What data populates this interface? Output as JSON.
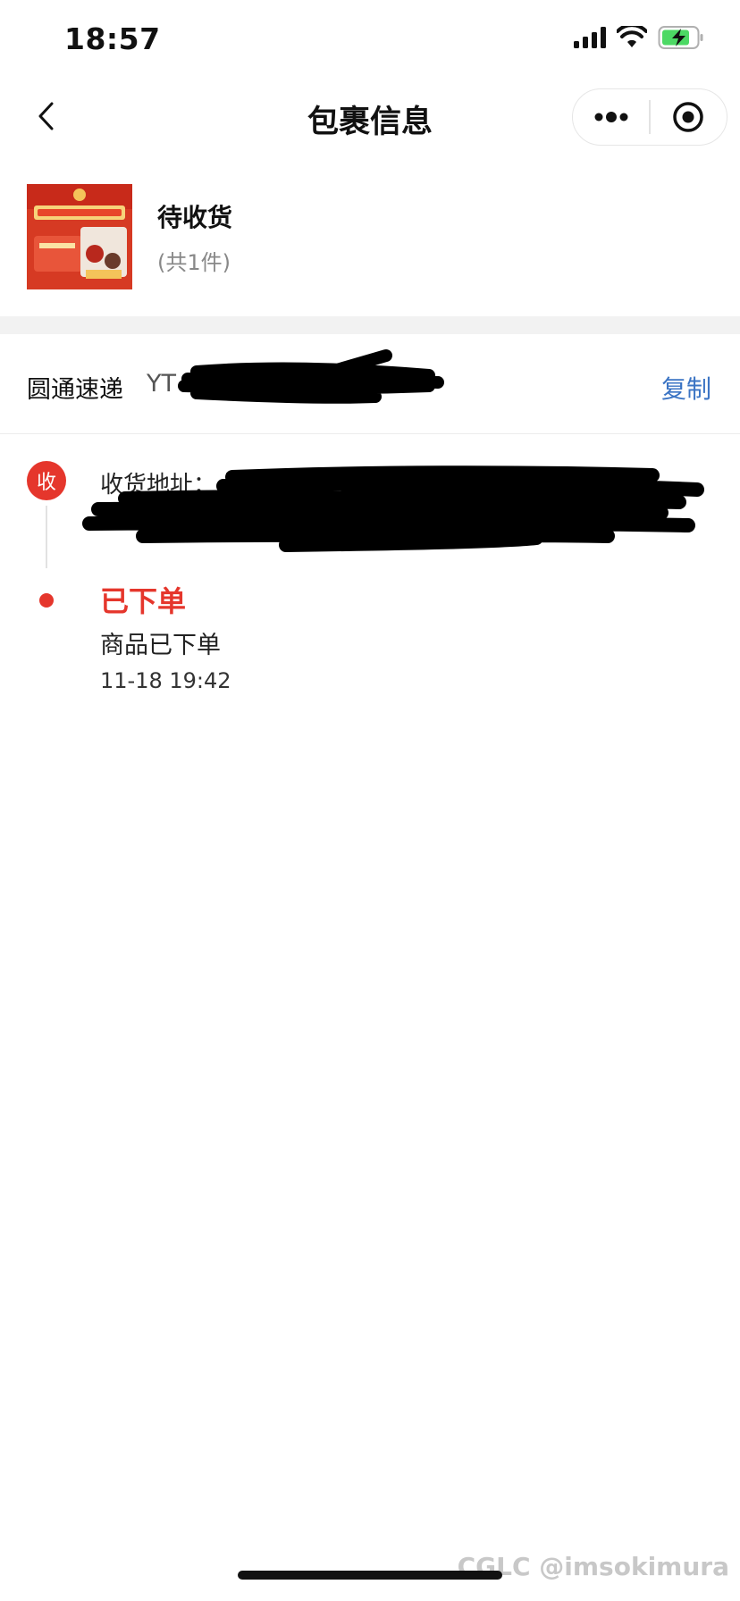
{
  "status_bar": {
    "time": "18:57",
    "icons": [
      "cellular-signal-icon",
      "wifi-icon",
      "battery-charging-icon"
    ],
    "battery_color": "#4cd964"
  },
  "nav": {
    "title": "包裹信息",
    "back_icon": "chevron-left-icon",
    "more_icon": "more-dots-icon",
    "close_icon": "target-circle-icon"
  },
  "product": {
    "status": "待收货",
    "count": "(共1件)"
  },
  "courier": {
    "name": "圆通速递",
    "tracking_visible": "YT",
    "copy_label": "复制"
  },
  "timeline": {
    "badge": "收",
    "address_label": "收货地址：上",
    "steps": [
      {
        "title": "已下单",
        "desc": "商品已下单",
        "time": "11-18 19:42"
      }
    ]
  },
  "watermark": "CGLC @imsokimura",
  "colors": {
    "accent_red": "#e5362c",
    "link_blue": "#3b74c4"
  }
}
